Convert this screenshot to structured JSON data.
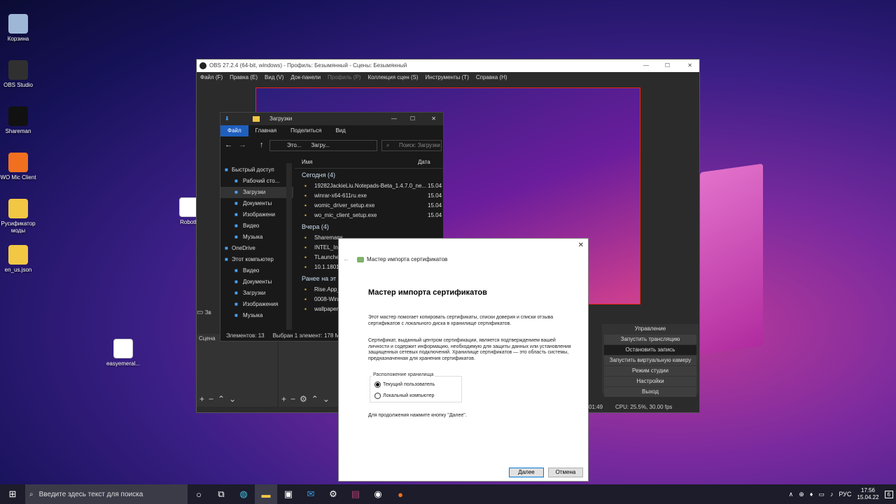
{
  "desktop_icons": [
    {
      "label": "Корзина",
      "icon": "recycle-bin-icon",
      "color": "#9fb7d6"
    },
    {
      "label": "OBS Studio",
      "icon": "obs-icon",
      "color": "#303030"
    },
    {
      "label": "Shareman",
      "icon": "shareman-icon",
      "color": "#111111"
    },
    {
      "label": "WO Mic Client",
      "icon": "mic-icon",
      "color": "#f07020"
    },
    {
      "label": "Русификатор моды",
      "icon": "folder-icon",
      "color": "#f2c744"
    },
    {
      "label": "en_us.json",
      "icon": "file-icon",
      "color": "#f2c744"
    },
    {
      "label": "Roboth",
      "icon": "java-icon",
      "color": "#ffffff"
    },
    {
      "label": "easyemeral...",
      "icon": "java-icon",
      "color": "#ffffff"
    }
  ],
  "obs": {
    "title": "OBS 27.2.4 (64-bit, windows) - Профиль: Безымянный - Сцены: Безымянный",
    "menu": [
      "Файл (F)",
      "Правка (E)",
      "Вид (V)",
      "Док-панели",
      "Профиль (P)",
      "Коллекция сцен (S)",
      "Инструменты (T)",
      "Справка (H)"
    ],
    "scene_label": "Сцена",
    "controls_title": "Управление",
    "controls": [
      "Запустить трансляцию",
      "Остановить запись",
      "Запустить виртуальную камеру",
      "Режим студии",
      "Настройки",
      "Выход"
    ],
    "status_time": "01:49",
    "status_cpu": "CPU: 25.5%, 30.00 fps",
    "audio_label": "Зв"
  },
  "explorer": {
    "title": "Загрузки",
    "ribbon": [
      "Файл",
      "Главная",
      "Поделиться",
      "Вид"
    ],
    "path": [
      "Это...",
      "Загру..."
    ],
    "search_placeholder": "Поиск: Загрузки",
    "nav": [
      {
        "label": "Быстрый доступ",
        "icon": "star-icon",
        "indent": 0
      },
      {
        "label": "Рабочий сто...",
        "icon": "desktop-icon",
        "indent": 1
      },
      {
        "label": "Загрузки",
        "icon": "download-icon",
        "indent": 1
      },
      {
        "label": "Документы",
        "icon": "documents-icon",
        "indent": 1
      },
      {
        "label": "Изображени",
        "icon": "pictures-icon",
        "indent": 1
      },
      {
        "label": "Видео",
        "icon": "video-icon",
        "indent": 1
      },
      {
        "label": "Музыка",
        "icon": "music-icon",
        "indent": 1
      },
      {
        "label": "OneDrive",
        "icon": "cloud-icon",
        "indent": 0
      },
      {
        "label": "Этот компьютер",
        "icon": "computer-icon",
        "indent": 0
      },
      {
        "label": "Видео",
        "icon": "video-icon",
        "indent": 1
      },
      {
        "label": "Документы",
        "icon": "documents-icon",
        "indent": 1
      },
      {
        "label": "Загрузки",
        "icon": "download-icon",
        "indent": 1
      },
      {
        "label": "Изображения",
        "icon": "pictures-icon",
        "indent": 1
      },
      {
        "label": "Музыка",
        "icon": "music-icon",
        "indent": 1
      }
    ],
    "columns": [
      "Имя",
      "Дата"
    ],
    "groups": [
      {
        "label": "Сегодня (4)",
        "files": [
          {
            "name": "19282JackieLiu.Notepads-Beta_1.4.7.0_ne...",
            "date": "15.04"
          },
          {
            "name": "winrar-x64-611ru.exe",
            "date": "15.04"
          },
          {
            "name": "womic_driver_setup.exe",
            "date": "15.04"
          },
          {
            "name": "wo_mic_client_setup.exe",
            "date": "15.04"
          }
        ]
      },
      {
        "label": "Вчера (4)",
        "files": [
          {
            "name": "Sharemans",
            "date": ""
          },
          {
            "name": "INTEL_Inte",
            "date": ""
          },
          {
            "name": "TLauncher",
            "date": ""
          },
          {
            "name": "10.1.18010.",
            "date": ""
          }
        ]
      },
      {
        "label": "Ранее на эт",
        "files": [
          {
            "name": "Rise.App_0",
            "date": ""
          },
          {
            "name": "0008-Win7",
            "date": ""
          },
          {
            "name": "wallpaperf",
            "date": ""
          }
        ]
      }
    ],
    "status": [
      "Элементов: 13",
      "Выбран 1 элемент: 178 МБ"
    ]
  },
  "dialog": {
    "header": "Мастер импорта сертификатов",
    "heading": "Мастер импорта сертификатов",
    "p1": "Этот мастер помогает копировать сертификаты, списки доверия и списки отзыва сертификатов с локального диска в хранилище сертификатов.",
    "p2": "Сертификат, выданный центром сертификации, является подтверждением вашей личности и содержит информацию, необходимую для защиты данных или установления защищенных сетевых подключений. Хранилище сертификатов — это область системы, предназначенная для хранения сертификатов.",
    "group_label": "Расположение хранилища",
    "radio1": "Текущий пользователь",
    "radio2": "Локальный компьютер",
    "p3": "Для продолжения нажмите кнопку \"Далее\".",
    "next": "Далее",
    "cancel": "Отмена"
  },
  "taskbar": {
    "search_placeholder": "Введите здесь текст для поиска",
    "lang": "РУС",
    "time": "17:56",
    "date": "15.04.22",
    "notifications": "6"
  }
}
